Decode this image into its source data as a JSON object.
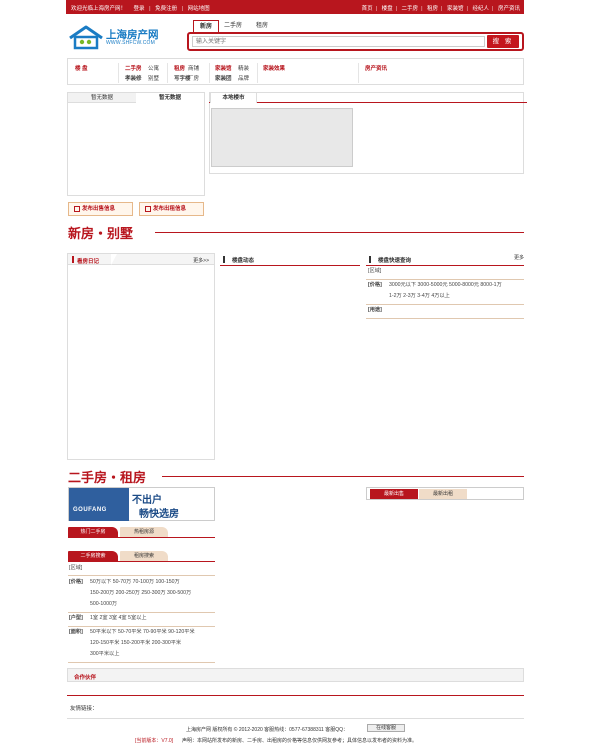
{
  "topbar": {
    "welcome": "欢迎光临上海房产网！",
    "login": "登录",
    "register": "免费注册",
    "sitemap": "网站地图",
    "links": [
      "首页",
      "楼盘",
      "二手房",
      "租房",
      "家装馆",
      "经纪人",
      "房产资讯"
    ]
  },
  "logo": {
    "name": "上海房产网",
    "url": "WWW.SHFCW.COM"
  },
  "search": {
    "tabs": [
      "新房",
      "二手房",
      "租房"
    ],
    "active_tab": "新房",
    "placeholder": "输入关键字",
    "button": "搜 索"
  },
  "nav": {
    "loupan": "楼 盘",
    "ershoufang": "二手房",
    "gongyu": "公寓",
    "biesu": "别墅",
    "zhuzhai": "孝装修",
    "zufang": "租房",
    "shangpu": "商铺",
    "xiezilou": "写字楼",
    "chanfang": "厂房",
    "jiazhuangguan": "家装馆",
    "shejishi": "精装",
    "jiazhuangtuan": "家装团",
    "pinpai": "品牌",
    "jiaju": "家装效果",
    "zixun": "房产资讯"
  },
  "left_panel": {
    "tabs": [
      "暂无数据",
      "暂无数据"
    ]
  },
  "right_panel": {
    "tab": "本地楼市"
  },
  "publish": {
    "sell": "发布出售信息",
    "rent": "发布出租信息"
  },
  "section_new": {
    "title": "新房・别墅",
    "diary": "看房日记",
    "more": "更多>>",
    "dynamic": "楼盘动态",
    "quick_search": "楼盘快速查询",
    "more2": "更多",
    "region_label": "[区域]",
    "price_label": "[价格]",
    "prices_row1": "3000元以下  3000-5000元  5000-8000元  8000-1万",
    "prices_row2": "1-2万  2-3万  3-4万  4万以上",
    "use_label": "[用途]"
  },
  "section_second": {
    "title": "二手房・租房",
    "banner_left": "GOUFANG",
    "banner_right1": "不出户",
    "banner_right2": "畅快选房",
    "tab_hot_second": "热门二手房",
    "tab_hot_rent": "热租房源",
    "tab_latest_sell": "最新出售",
    "tab_latest_rent": "最新出租",
    "search_tab1": "二手房搜索",
    "search_tab2": "租房搜索",
    "region_label": "[区域]",
    "price_label": "[价格]",
    "price_row1": "50万以下  50-70万  70-100万  100-150万",
    "price_row2": "150-200万  200-250万  250-300万  300-500万",
    "price_row3": "500-1000万",
    "room_label": "[户型]",
    "rooms": "1室  2室  3室  4室  5室以上",
    "area_label": "[面积]",
    "area_row1": "50平米以下  50-70平米  70-90平米  90-120平米",
    "area_row2": "120-150平米  150-200平米  200-300平米",
    "area_row3": "300平米以上"
  },
  "partners": {
    "title": "合作伙伴",
    "links_label": "友情链接："
  },
  "footer": {
    "line1": "上海房产网  版权所有 © 2012-2020  客服热线：0577-67388311  客服QQ：",
    "qq_btn": "在线客服",
    "line2_label": "[当前版本：V7.0]",
    "line2": "声明：本网站所发布的新房、二手房、出租房的价格等信息仅供网友参考；具体信息以发布者的资料为准。"
  },
  "colors": {
    "brand": "#b8161e",
    "logo": "#1a7cc4"
  }
}
